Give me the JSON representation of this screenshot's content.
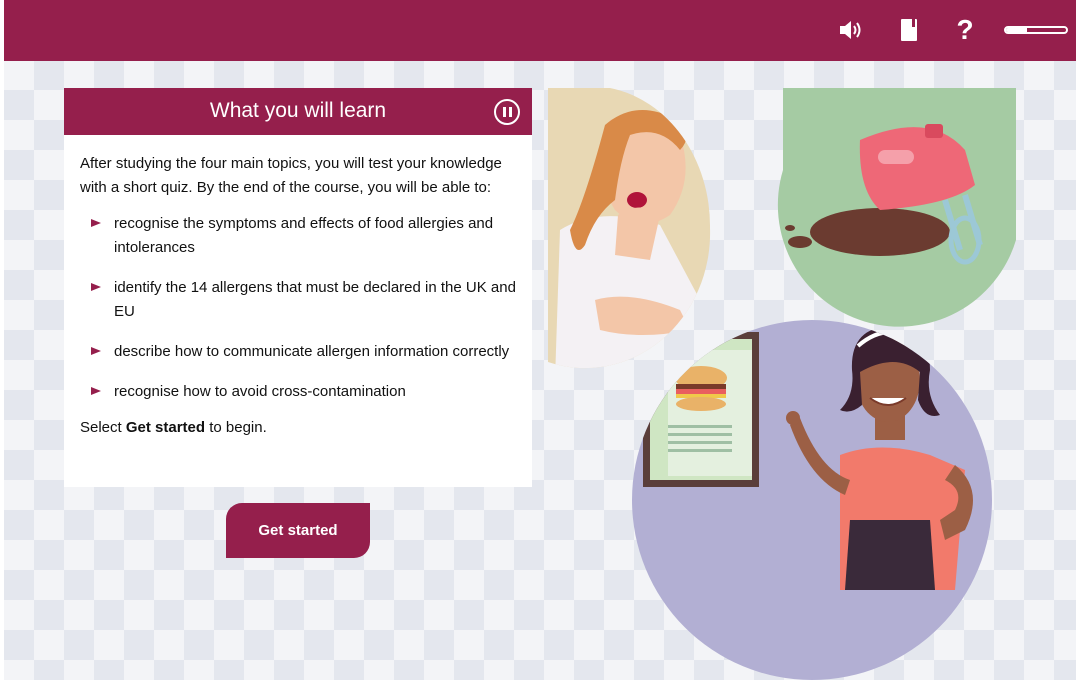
{
  "topbar": {
    "icons": [
      "speaker-icon",
      "book-icon",
      "help-icon"
    ],
    "help_glyph": "?",
    "progress": 0.35
  },
  "card": {
    "title": "What you will learn",
    "intro": "After studying the four main topics, you will test your knowledge with a short quiz. By the end of the course, you will be able to:",
    "items": [
      "recognise the symptoms and effects of food allergies and intolerances",
      "identify the 14 allergens that must be declared in the UK and EU",
      "describe how to communicate allergen information correctly",
      "recognise how to avoid cross-contamination"
    ],
    "outro_prefix": "Select ",
    "outro_bold": "Get started",
    "outro_suffix": " to begin."
  },
  "button": {
    "label": "Get started"
  },
  "colors": {
    "brand": "#951f4c",
    "background_pattern": "#e4e7ee"
  }
}
